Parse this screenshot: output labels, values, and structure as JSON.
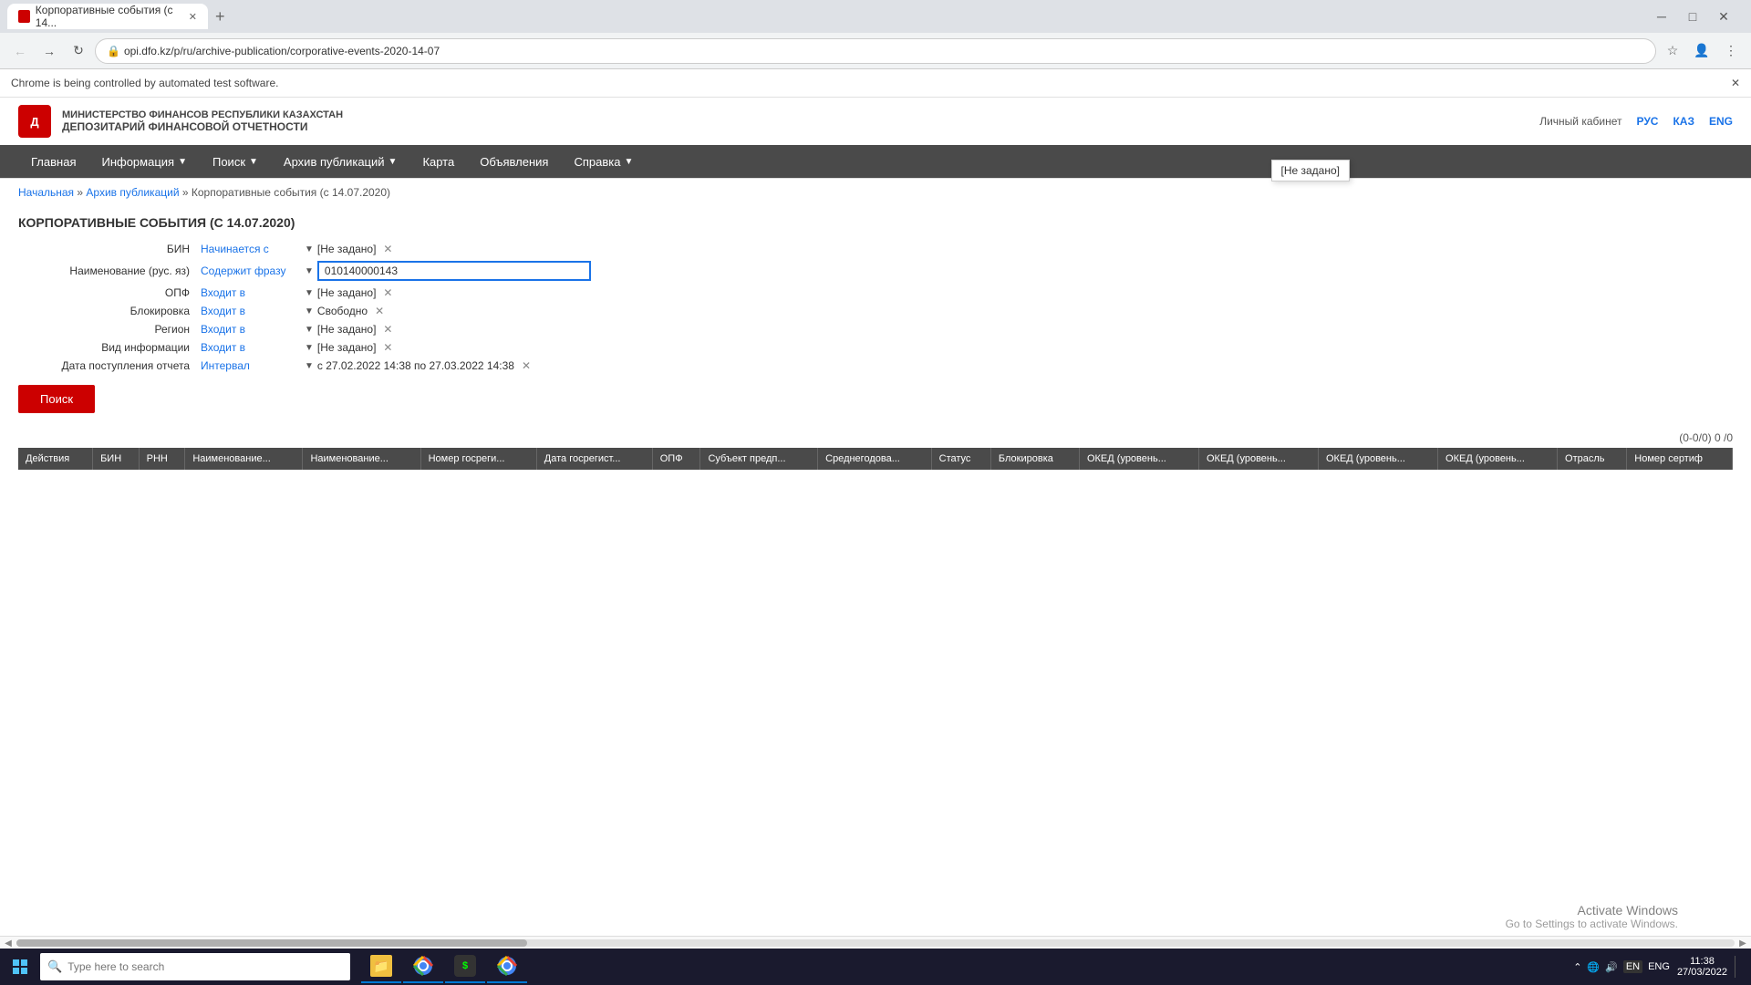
{
  "browser": {
    "tab_title": "Корпоративные события (с 14...",
    "url": "opi.dfo.kz/p/ru/archive-publication/corporative-events-2020-14-07",
    "notification": "Chrome is being controlled by automated test software."
  },
  "header": {
    "logo_abbr": "ДФО",
    "logo_top": "МИНИСТЕРСТВО ФИНАНСОВ РЕСПУБЛИКИ КАЗАХСТАН",
    "logo_bottom": "ДЕПОЗИТАРИЙ ФИНАНСОВОЙ ОТЧЕТНОСТИ",
    "personal_cabinet": "Личный кабинет",
    "lang_rус": "РУС",
    "lang_kaz": "КАЗ",
    "lang_eng": "ENG"
  },
  "nav": {
    "items": [
      {
        "label": "Главная"
      },
      {
        "label": "Информация",
        "hasDropdown": true
      },
      {
        "label": "Поиск",
        "hasDropdown": true
      },
      {
        "label": "Архив публикаций",
        "hasDropdown": true
      },
      {
        "label": "Карта"
      },
      {
        "label": "Объявления"
      },
      {
        "label": "Справка",
        "hasDropdown": true
      }
    ]
  },
  "breadcrumb": {
    "home": "Начальная",
    "archive": "Архив публикаций",
    "current": "Корпоративные события (с 14.07.2020)"
  },
  "page_title": "КОРПОРАТИВНЫЕ СОБЫТИЯ (С 14.07.2020)",
  "filters": {
    "bin_label": "БИН",
    "bin_condition": "Начинается с",
    "bin_value": "[Не задано]",
    "name_label": "Наименование (рус. яз)",
    "name_condition": "Содержит фразу",
    "name_value": "010140000143",
    "opf_label": "ОПФ",
    "opf_condition": "Входит в",
    "opf_value": "[Не задано]",
    "block_label": "Блокировка",
    "block_condition": "Входит в",
    "block_value": "Свободно",
    "region_label": "Регион",
    "region_condition": "Входит в",
    "region_value": "[Не задано]",
    "info_type_label": "Вид информации",
    "info_type_condition": "Входит в",
    "info_type_value": "[Не задано]",
    "date_label": "Дата поступления отчета",
    "date_condition": "Интервал",
    "date_value": "с 27.02.2022 14:38 по 27.03.2022 14:38",
    "search_button": "Поиск"
  },
  "tooltip": {
    "text": "[Не задано]"
  },
  "table": {
    "pagination": "(0-0/0)",
    "page_current": "0",
    "page_total": "/0",
    "columns": [
      "Действия",
      "БИН",
      "РНН",
      "Наименование...",
      "Наименование...",
      "Номер госреги...",
      "Дата госрегист...",
      "ОПФ",
      "Субъект предп...",
      "Среднегодова...",
      "Статус",
      "Блокировка",
      "ОКЕД (уровень...",
      "ОКЕД (уровень...",
      "ОКЕД (уровень...",
      "ОКЕД (уровень...",
      "Отрасль",
      "Номер сертиф"
    ]
  },
  "taskbar": {
    "search_placeholder": "Type here to search",
    "time": "11:38",
    "date": "27/03/2022",
    "lang": "ENG"
  },
  "activate_windows": {
    "line1": "Activate Windows",
    "line2": "Go to Settings to activate Windows."
  }
}
